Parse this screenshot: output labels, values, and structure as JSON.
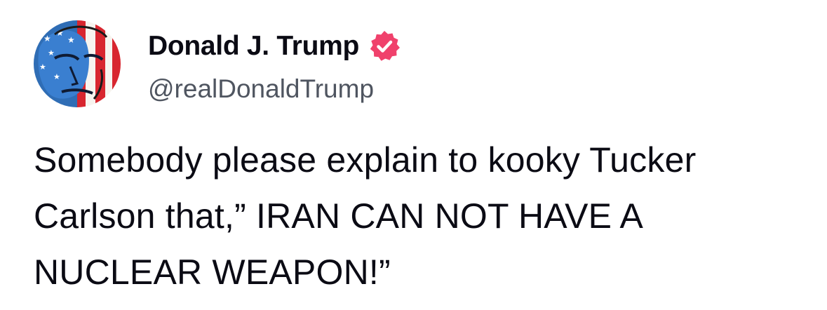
{
  "author": {
    "display_name": "Donald J. Trump",
    "handle": "@realDonaldTrump",
    "verified_icon": "verified-badge-icon",
    "badge_color": "#f0416c"
  },
  "post": {
    "text": "Somebody please explain to kooky Tucker Carlson that,” IRAN CAN NOT HAVE A NUCLEAR WEAPON!”"
  }
}
